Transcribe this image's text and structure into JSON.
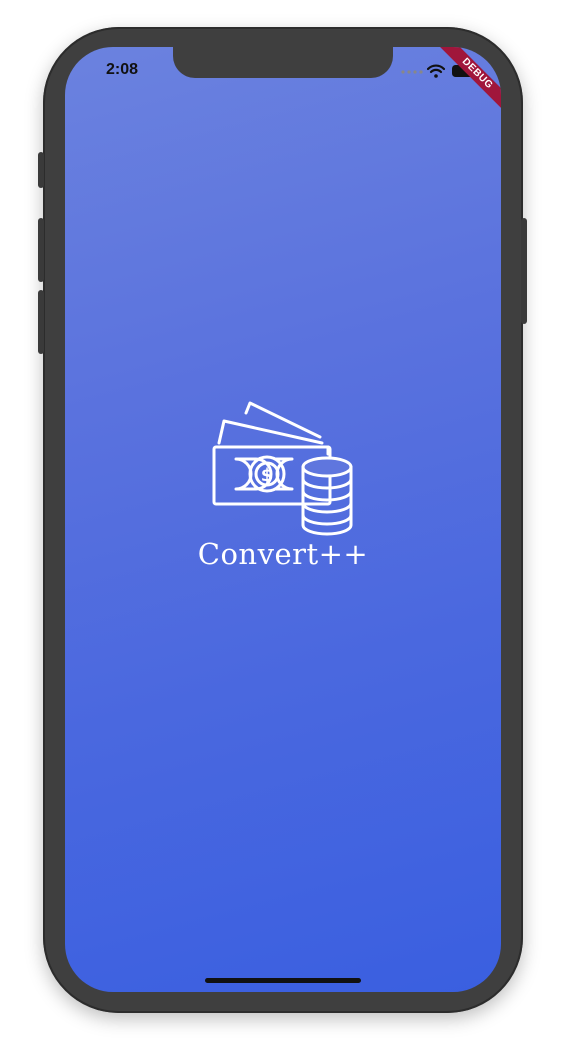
{
  "status_bar": {
    "time": "2:08",
    "debug_label": "DEBUG"
  },
  "splash": {
    "title": "Convert++",
    "logo_icon": "money-cash-coins-icon"
  },
  "colors": {
    "gradient_top": "#6b82df",
    "gradient_bottom": "#3a5fe0",
    "debug_banner": "#a0163b",
    "foreground": "#ffffff"
  }
}
